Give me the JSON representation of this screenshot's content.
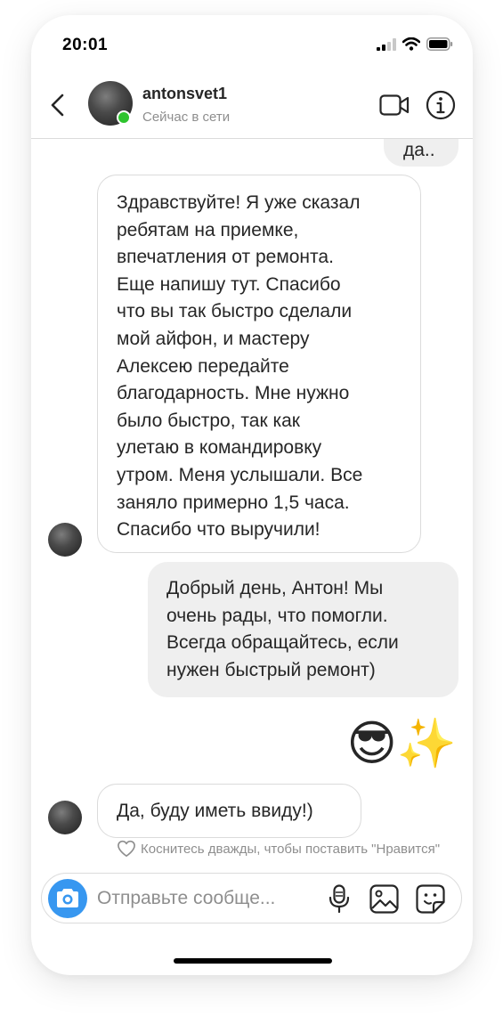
{
  "status_bar": {
    "time": "20:01"
  },
  "header": {
    "username": "antonsvet1",
    "presence": "Сейчас в сети"
  },
  "messages": {
    "partial_top": "да..",
    "incoming_1": [
      "Здравствуйте! Я уже сказал",
      "ребятам на приемке,",
      "впечатления от ремонта.",
      "Еще напишу тут. Спасибо",
      "что вы так быстро сделали",
      "мой айфон, и мастеру",
      "Алексею передайте",
      "благодарность. Мне нужно",
      "было быстро, так как",
      "улетаю в командировку",
      "утром. Меня услышали. Все",
      "заняло примерно 1,5 часа.",
      "Спасибо что выручили!"
    ],
    "outgoing_1": [
      "Добрый день, Антон! Мы",
      "очень рады, что помогли.",
      "Всегда обращайтесь, если",
      "нужен быстрый ремонт)"
    ],
    "emoji": "😎✨",
    "incoming_2": "Да, буду иметь ввиду!)"
  },
  "hint": {
    "text": "Коснитесь дважды, чтобы поставить \"Нравится\""
  },
  "composer": {
    "placeholder": "Отправьте сообще..."
  },
  "colors": {
    "accent": "#3797f0",
    "online": "#2ec42e",
    "outgoing_bubble": "#efefef",
    "border": "#dbdbdb"
  }
}
